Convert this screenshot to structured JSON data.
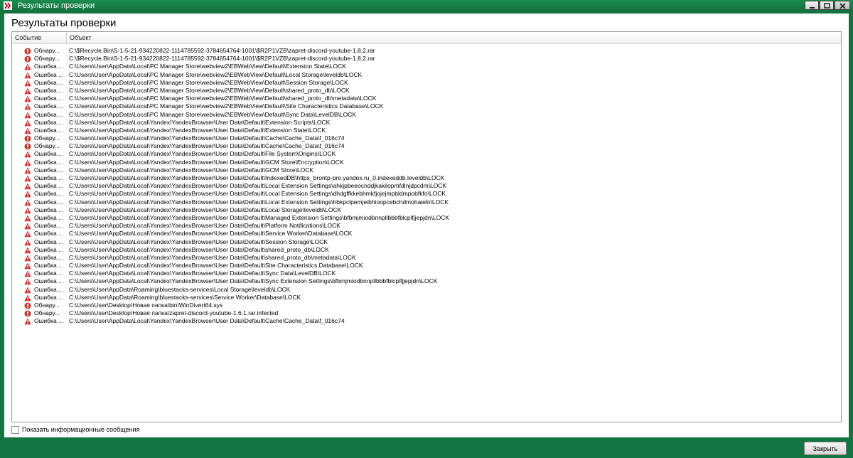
{
  "window": {
    "title": "Результаты проверки"
  },
  "page": {
    "heading": "Результаты проверки"
  },
  "table": {
    "columns": {
      "event": "Событие",
      "object": "Объект"
    },
    "rows": [
      {
        "type": "detect",
        "event": "Обнару...",
        "object": "C:\\$Recycle.Bin\\S-1-5-21-934220822-1114785592-3784654764-1001\\$R2P1VZB\\zapret-discord-youtube-1.8.2.rar"
      },
      {
        "type": "detect",
        "event": "Обнару...",
        "object": "C:\\$Recycle.Bin\\S-1-5-21-934220822-1114785592-3784654764-1001\\$R2P1VZB\\zapret-discord-youtube-1.8.2.rar"
      },
      {
        "type": "error",
        "event": "Ошибка ...",
        "object": "C:\\Users\\User\\AppData\\Local\\PC Manager Store\\webview2\\EBWebView\\Default\\Extension State\\LOCK"
      },
      {
        "type": "error",
        "event": "Ошибка ...",
        "object": "C:\\Users\\User\\AppData\\Local\\PC Manager Store\\webview2\\EBWebView\\Default\\Local Storage\\leveldb\\LOCK"
      },
      {
        "type": "error",
        "event": "Ошибка ...",
        "object": "C:\\Users\\User\\AppData\\Local\\PC Manager Store\\webview2\\EBWebView\\Default\\Session Storage\\LOCK"
      },
      {
        "type": "error",
        "event": "Ошибка ...",
        "object": "C:\\Users\\User\\AppData\\Local\\PC Manager Store\\webview2\\EBWebView\\Default\\shared_proto_db\\LOCK"
      },
      {
        "type": "error",
        "event": "Ошибка ...",
        "object": "C:\\Users\\User\\AppData\\Local\\PC Manager Store\\webview2\\EBWebView\\Default\\shared_proto_db\\metadata\\LOCK"
      },
      {
        "type": "error",
        "event": "Ошибка ...",
        "object": "C:\\Users\\User\\AppData\\Local\\PC Manager Store\\webview2\\EBWebView\\Default\\Site Characteristics Database\\LOCK"
      },
      {
        "type": "error",
        "event": "Ошибка ...",
        "object": "C:\\Users\\User\\AppData\\Local\\PC Manager Store\\webview2\\EBWebView\\Default\\Sync Data\\LevelDB\\LOCK"
      },
      {
        "type": "error",
        "event": "Ошибка ...",
        "object": "C:\\Users\\User\\AppData\\Local\\Yandex\\YandexBrowser\\User Data\\Default\\Extension Scripts\\LOCK"
      },
      {
        "type": "error",
        "event": "Ошибка ...",
        "object": "C:\\Users\\User\\AppData\\Local\\Yandex\\YandexBrowser\\User Data\\Default\\Extension State\\LOCK"
      },
      {
        "type": "detect",
        "event": "Обнару...",
        "object": "C:\\Users\\User\\AppData\\Local\\Yandex\\YandexBrowser\\User Data\\Default\\Cache\\Cache_Data\\f_016c74"
      },
      {
        "type": "detect",
        "event": "Обнару...",
        "object": "C:\\Users\\User\\AppData\\Local\\Yandex\\YandexBrowser\\User Data\\Default\\Cache\\Cache_Data\\f_016c74"
      },
      {
        "type": "error",
        "event": "Ошибка ...",
        "object": "C:\\Users\\User\\AppData\\Local\\Yandex\\YandexBrowser\\User Data\\Default\\File System\\Origins\\LOCK"
      },
      {
        "type": "error",
        "event": "Ошибка ...",
        "object": "C:\\Users\\User\\AppData\\Local\\Yandex\\YandexBrowser\\User Data\\Default\\GCM Store\\Encryption\\LOCK"
      },
      {
        "type": "error",
        "event": "Ошибка ...",
        "object": "C:\\Users\\User\\AppData\\Local\\Yandex\\YandexBrowser\\User Data\\Default\\GCM Store\\LOCK"
      },
      {
        "type": "error",
        "event": "Ошибка ...",
        "object": "C:\\Users\\User\\AppData\\Local\\Yandex\\YandexBrowser\\User Data\\Default\\IndexedDB\\https_brontp-pre.yandex.ru_0.indexeddb.leveldb\\LOCK"
      },
      {
        "type": "error",
        "event": "Ошибка ...",
        "object": "C:\\Users\\User\\AppData\\Local\\Yandex\\YandexBrowser\\User Data\\Default\\Local Extension Settings\\ahkjpbeeocnddjkakilopmfdlnjdpcdm\\LOCK"
      },
      {
        "type": "error",
        "event": "Ошибка ...",
        "object": "C:\\Users\\User\\AppData\\Local\\Yandex\\YandexBrowser\\User Data\\Default\\Local Extension Settings\\dhdgffkkebhmkfjojejmpbldmpobfkfo\\LOCK"
      },
      {
        "type": "error",
        "event": "Ошибка ...",
        "object": "C:\\Users\\User\\AppData\\Local\\Yandex\\YandexBrowser\\User Data\\Default\\Local Extension Settings\\hbkpclpemjeibhioopcebchdmohaieln\\LOCK"
      },
      {
        "type": "error",
        "event": "Ошибка ...",
        "object": "C:\\Users\\User\\AppData\\Local\\Yandex\\YandexBrowser\\User Data\\Default\\Local Storage\\leveldb\\LOCK"
      },
      {
        "type": "error",
        "event": "Ошибка ...",
        "object": "C:\\Users\\User\\AppData\\Local\\Yandex\\YandexBrowser\\User Data\\Default\\Managed Extension Settings\\bfbmjmiodbnnpllbbbfblcplfjjepjdn\\LOCK"
      },
      {
        "type": "error",
        "event": "Ошибка ...",
        "object": "C:\\Users\\User\\AppData\\Local\\Yandex\\YandexBrowser\\User Data\\Default\\Platform Notifications\\LOCK"
      },
      {
        "type": "error",
        "event": "Ошибка ...",
        "object": "C:\\Users\\User\\AppData\\Local\\Yandex\\YandexBrowser\\User Data\\Default\\Service Worker\\Database\\LOCK"
      },
      {
        "type": "error",
        "event": "Ошибка ...",
        "object": "C:\\Users\\User\\AppData\\Local\\Yandex\\YandexBrowser\\User Data\\Default\\Session Storage\\LOCK"
      },
      {
        "type": "error",
        "event": "Ошибка ...",
        "object": "C:\\Users\\User\\AppData\\Local\\Yandex\\YandexBrowser\\User Data\\Default\\shared_proto_db\\LOCK"
      },
      {
        "type": "error",
        "event": "Ошибка ...",
        "object": "C:\\Users\\User\\AppData\\Local\\Yandex\\YandexBrowser\\User Data\\Default\\shared_proto_db\\metadata\\LOCK"
      },
      {
        "type": "error",
        "event": "Ошибка ...",
        "object": "C:\\Users\\User\\AppData\\Local\\Yandex\\YandexBrowser\\User Data\\Default\\Site Characteristics Database\\LOCK"
      },
      {
        "type": "error",
        "event": "Ошибка ...",
        "object": "C:\\Users\\User\\AppData\\Local\\Yandex\\YandexBrowser\\User Data\\Default\\Sync Data\\LevelDB\\LOCK"
      },
      {
        "type": "error",
        "event": "Ошибка ...",
        "object": "C:\\Users\\User\\AppData\\Local\\Yandex\\YandexBrowser\\User Data\\Default\\Sync Extension Settings\\bfbmjmiodbnnpllbbbfblcplfjjepjdn\\LOCK"
      },
      {
        "type": "error",
        "event": "Ошибка ...",
        "object": "C:\\Users\\User\\AppData\\Roaming\\bluestacks-services\\Local Storage\\leveldb\\LOCK"
      },
      {
        "type": "error",
        "event": "Ошибка ...",
        "object": "C:\\Users\\User\\AppData\\Roaming\\bluestacks-services\\Service Worker\\Database\\LOCK"
      },
      {
        "type": "detect",
        "event": "Обнару...",
        "object": "C:\\Users\\User\\Desktop\\Новая папка\\bin\\WinDivert64.sys"
      },
      {
        "type": "detect",
        "event": "Обнару...",
        "object": "C:\\Users\\User\\Desktop\\Новая папка\\zapret-discord-youtube-1.6.1.rar.infected"
      },
      {
        "type": "error",
        "event": "Ошибка ...",
        "object": "C:\\Users\\User\\AppData\\Local\\Yandex\\YandexBrowser\\User Data\\Default\\Cache\\Cache_Data\\f_016c74"
      }
    ]
  },
  "footer": {
    "show_info_checkbox": {
      "label": "Показать информационные сообщения",
      "checked": false
    },
    "close_button": "Закрыть"
  },
  "colors": {
    "window_frame": "#157542",
    "error_icon": "#d42a2a",
    "detect_icon": "#c0392b"
  },
  "icons": {
    "detect": "detect-circle-icon",
    "error": "warning-triangle-icon"
  }
}
